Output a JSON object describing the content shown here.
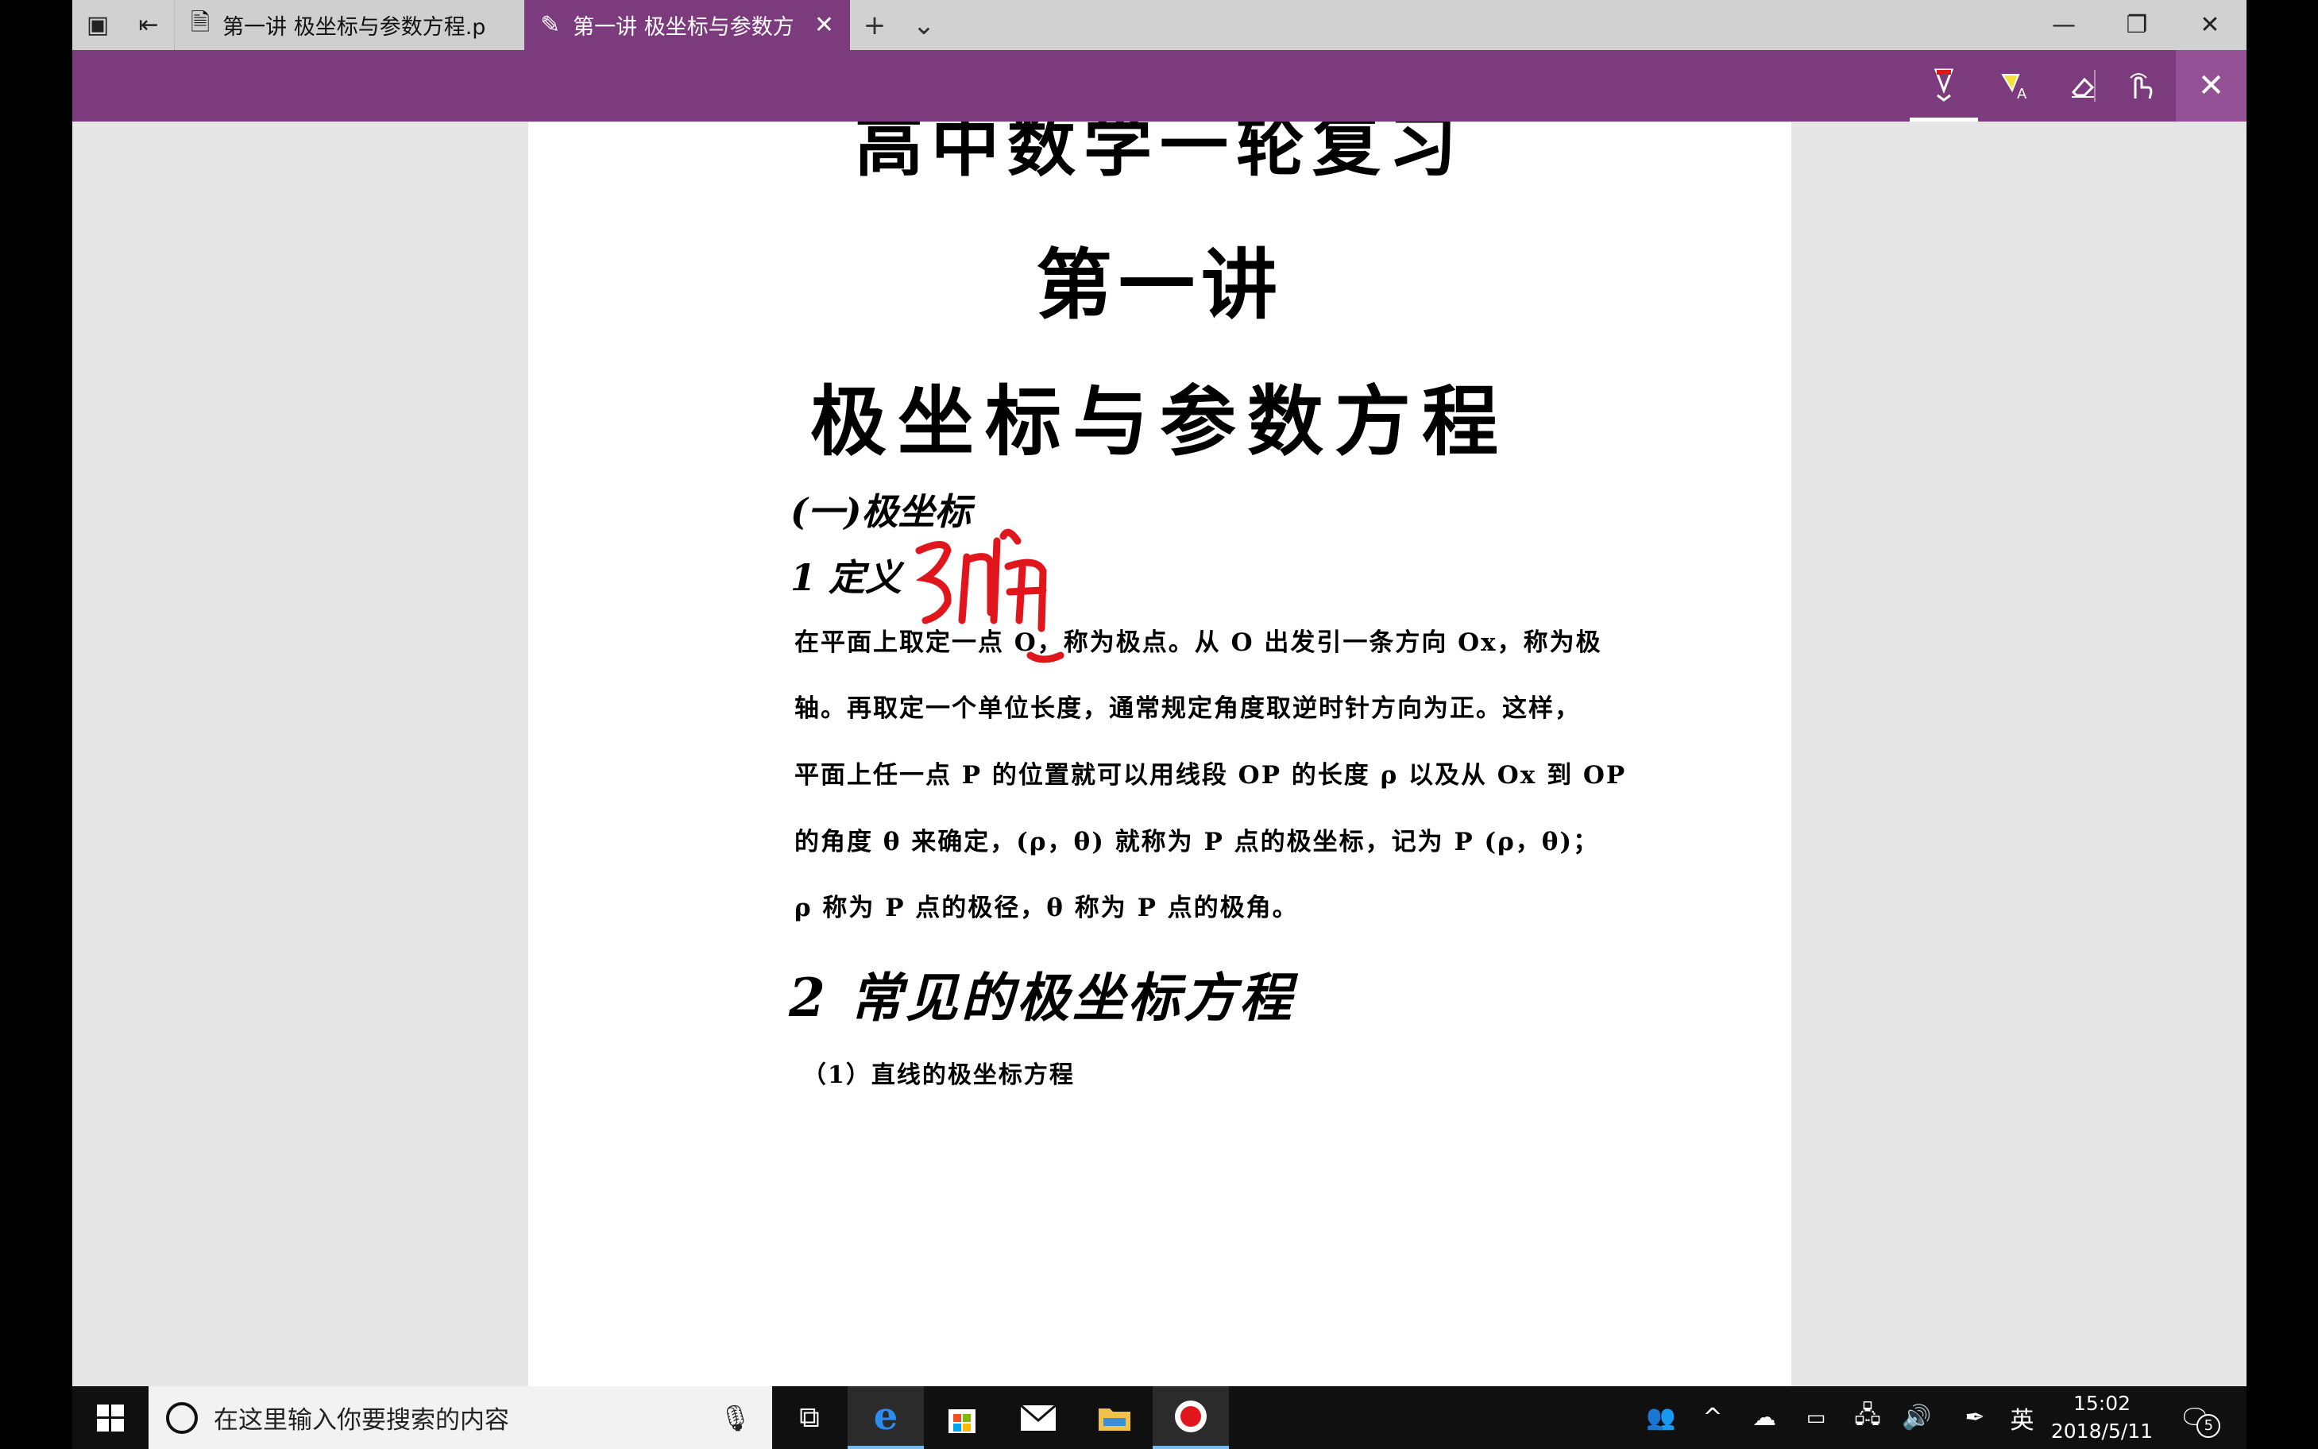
{
  "tabs": [
    {
      "label": "第一讲 极坐标与参数方程.p",
      "icon": "pdf-icon",
      "active": false
    },
    {
      "label": "第一讲 极坐标与参数方",
      "icon": "pen-icon",
      "active": true
    }
  ],
  "inktools": [
    "ballpoint-pen-icon",
    "highlighter-icon",
    "eraser-icon",
    "touch-writing-icon"
  ],
  "document": {
    "title_line1": "高中数学一轮复习",
    "title_line2": "第一讲",
    "title_line3": "极坐标与参数方程",
    "section1": "(一)极坐标",
    "definition_heading": "1 定义",
    "annotation_text": "弸",
    "paragraph_lines": [
      "在平面上取定一点 O，称为极点。从 O 出发引一条方向 Ox，称为极",
      "轴。再取定一个单位长度，通常规定角度取逆时针方向为正。这样，",
      "平面上任一点 P 的位置就可以用线段 OP 的长度 ρ 以及从 Ox 到 OP",
      "的角度 θ 来确定，(ρ，θ) 就称为 P 点的极坐标，记为 P (ρ，θ)；",
      "ρ 称为 P 点的极径，θ 称为 P 点的极角。"
    ],
    "section2": "2 常见的极坐标方程",
    "subsection": "（1）直线的极坐标方程"
  },
  "taskbar": {
    "search_placeholder": "在这里输入你要搜索的内容",
    "time": "15:02",
    "date": "2018/5/11",
    "ime": "英",
    "notification_count": "5"
  },
  "colors": {
    "accent": "#7b3b7c",
    "ink": "#e0161c"
  }
}
